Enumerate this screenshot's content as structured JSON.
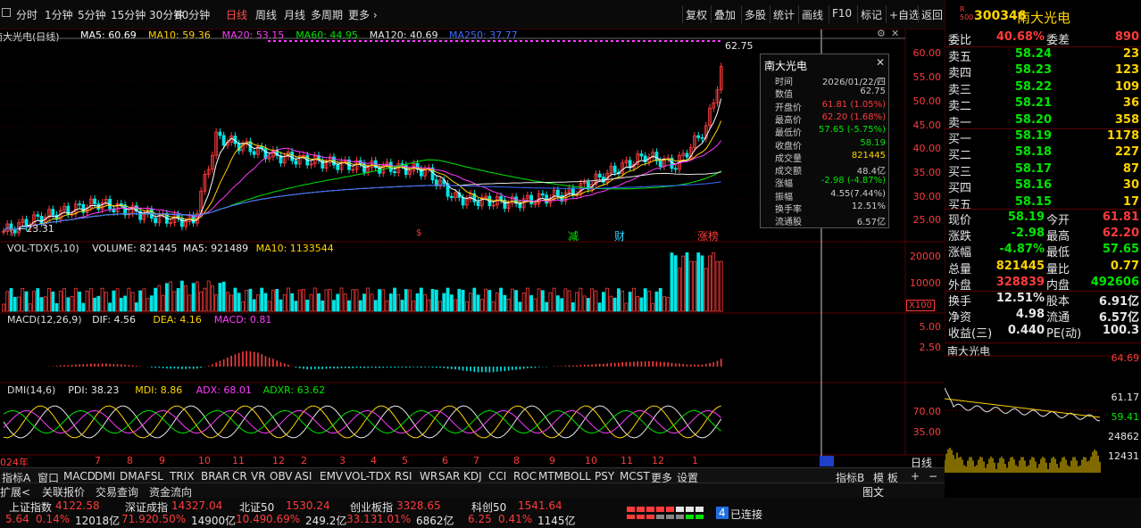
{
  "toolbar": {
    "left_items": [
      "分时",
      "1分钟",
      "5分钟",
      "15分钟",
      "30分钟",
      "60分钟",
      "日线",
      "周线",
      "月线",
      "多周期",
      "更多"
    ],
    "active": "日线",
    "right_items": [
      "复权",
      "叠加",
      "多股",
      "统计",
      "画线",
      "F10",
      "标记",
      "+自选",
      "返回"
    ]
  },
  "stock": {
    "code": "300346",
    "name": "南大光电",
    "market_badge": "R 500"
  },
  "main_chart": {
    "legend_title": "南大光电(日线)",
    "ma": [
      {
        "label": "MA5: 60.69",
        "color": "#ffffff"
      },
      {
        "label": "MA10: 59.36",
        "color": "#ffd400"
      },
      {
        "label": "MA20: 53.15",
        "color": "#ff3bff"
      },
      {
        "label": "MA60: 44.95",
        "color": "#00e600"
      },
      {
        "label": "MA120: 40.69",
        "color": "#e6e6e6"
      },
      {
        "label": "MA250: 37.77",
        "color": "#3b6bff"
      }
    ],
    "y_ticks": [
      "60.00",
      "55.00",
      "50.00",
      "45.00",
      "40.00",
      "35.00",
      "30.00",
      "25.00"
    ],
    "high_marker": "62.75",
    "low_marker": "←23.31",
    "event_marks": [
      {
        "text": "减",
        "color": "#00e600"
      },
      {
        "text": "财",
        "color": "#2ad2ff"
      },
      {
        "text": "涨榜",
        "color": "#ff3b3b"
      }
    ]
  },
  "tooltip": {
    "title": "南大光电",
    "rows": [
      {
        "k": "时间",
        "v": "2026/01/22/四",
        "c": "#cccccc"
      },
      {
        "k": "数值",
        "v": "62.75",
        "c": "#cccccc"
      },
      {
        "k": "开盘价",
        "v": "61.81 (1.05%)",
        "c": "#ff3b3b"
      },
      {
        "k": "最高价",
        "v": "62.20 (1.68%)",
        "c": "#ff3b3b"
      },
      {
        "k": "最低价",
        "v": "57.65 (-5.75%)",
        "c": "#00e600"
      },
      {
        "k": "收盘价",
        "v": "58.19",
        "c": "#00e600"
      },
      {
        "k": "成交量",
        "v": "821445",
        "c": "#ffd400"
      },
      {
        "k": "成交额",
        "v": "48.4亿",
        "c": "#cccccc"
      },
      {
        "k": "涨幅",
        "v": "-2.98 (-4.87%)",
        "c": "#00e600"
      },
      {
        "k": "振幅",
        "v": "4.55(7.44%)",
        "c": "#cccccc"
      },
      {
        "k": "换手率",
        "v": "12.51%",
        "c": "#cccccc"
      },
      {
        "k": "流通股",
        "v": "6.57亿",
        "c": "#cccccc"
      }
    ]
  },
  "volume": {
    "legend": [
      {
        "t": "VOL-TDX(5,10)",
        "c": "#dddddd"
      },
      {
        "t": "VOLUME: 821445",
        "c": "#e6e6e6"
      },
      {
        "t": "MA5: 921489",
        "c": "#e6e6e6"
      },
      {
        "t": "MA10: 1133544",
        "c": "#ffd400"
      }
    ],
    "y_ticks": [
      "20000",
      "10000"
    ],
    "unit": "X100"
  },
  "macd": {
    "legend": [
      {
        "t": "MACD(12,26,9)",
        "c": "#dddddd"
      },
      {
        "t": "DIF: 4.56",
        "c": "#e6e6e6"
      },
      {
        "t": "DEA: 4.16",
        "c": "#ffd400"
      },
      {
        "t": "MACD: 0.81",
        "c": "#ff3bff"
      }
    ],
    "y_ticks": [
      "5.00",
      "2.50"
    ]
  },
  "dmi": {
    "legend": [
      {
        "t": "DMI(14,6)",
        "c": "#dddddd"
      },
      {
        "t": "PDI: 38.23",
        "c": "#e6e6e6"
      },
      {
        "t": "MDI: 8.86",
        "c": "#ffd400"
      },
      {
        "t": "ADX: 68.01",
        "c": "#ff3bff"
      },
      {
        "t": "ADXR: 63.62",
        "c": "#00e600"
      }
    ],
    "y_ticks": [
      "70.00",
      "35.00"
    ]
  },
  "x_axis": {
    "labels": [
      "024年",
      "7",
      "8",
      "9",
      "10",
      "11",
      "12",
      "2",
      "3",
      "4",
      "5",
      "6",
      "7",
      "8",
      "9",
      "10",
      "11",
      "12",
      "1"
    ],
    "right_label": "日线"
  },
  "bottom_tabs": [
    "指标A",
    "窗口",
    "MACD",
    "DMI",
    "DMA",
    "FSL",
    "TRIX",
    "BRAR",
    "CR",
    "VR",
    "OBV",
    "ASI",
    "EMV",
    "VOL-TDX",
    "RSI",
    "WR",
    "SAR",
    "KDJ",
    "CCI",
    "ROC",
    "MTM",
    "BOLL",
    "PSY",
    "MCST",
    "更多",
    "设置"
  ],
  "bottom_right_tabs": [
    "指标B",
    "模 板"
  ],
  "extra_tabs": [
    "扩展<",
    "关联报价",
    "交易查询",
    "资金流向"
  ],
  "quote": {
    "weibi": {
      "k": "委比",
      "v": "40.68%",
      "k2": "委差",
      "v2": "890"
    },
    "sell": [
      {
        "k": "卖五",
        "p": "58.24",
        "q": "23"
      },
      {
        "k": "卖四",
        "p": "58.23",
        "q": "123"
      },
      {
        "k": "卖三",
        "p": "58.22",
        "q": "109"
      },
      {
        "k": "卖二",
        "p": "58.21",
        "q": "36"
      },
      {
        "k": "卖一",
        "p": "58.20",
        "q": "358"
      }
    ],
    "buy": [
      {
        "k": "买一",
        "p": "58.19",
        "q": "1178"
      },
      {
        "k": "买二",
        "p": "58.18",
        "q": "227"
      },
      {
        "k": "买三",
        "p": "58.17",
        "q": "87"
      },
      {
        "k": "买四",
        "p": "58.16",
        "q": "30"
      },
      {
        "k": "买五",
        "p": "58.15",
        "q": "17"
      }
    ],
    "stats": [
      {
        "k": "现价",
        "v": "58.19",
        "vc": "#00e600",
        "k2": "今开",
        "v2": "61.81",
        "v2c": "#ff3b3b"
      },
      {
        "k": "涨跌",
        "v": "-2.98",
        "vc": "#00e600",
        "k2": "最高",
        "v2": "62.20",
        "v2c": "#ff3b3b"
      },
      {
        "k": "涨幅",
        "v": "-4.87%",
        "vc": "#00e600",
        "k2": "最低",
        "v2": "57.65",
        "v2c": "#00e600"
      },
      {
        "k": "总量",
        "v": "821445",
        "vc": "#ffd400",
        "k2": "量比",
        "v2": "0.77",
        "v2c": "#ffd400"
      },
      {
        "k": "外盘",
        "v": "328839",
        "vc": "#ff3b3b",
        "k2": "内盘",
        "v2": "492606",
        "v2c": "#00e600"
      }
    ],
    "stats2": [
      {
        "k": "换手",
        "v": "12.51%",
        "k2": "股本",
        "v2": "6.91亿"
      },
      {
        "k": "净资",
        "v": "4.98",
        "k2": "流通",
        "v2": "6.57亿"
      },
      {
        "k": "收益(三)",
        "v": "0.440",
        "k2": "PE(动)",
        "v2": "100.3"
      }
    ]
  },
  "mini_chart": {
    "title": "南大光电",
    "y_ticks": [
      "64.69",
      "61.17",
      "59.41",
      "24862",
      "12431"
    ]
  },
  "right_bottom": {
    "tab": "图文"
  },
  "status": {
    "indices": [
      {
        "name": "上证指数",
        "val": "4122.58",
        "chg": "5.64",
        "pct": "0.14%",
        "amt": "12018亿"
      },
      {
        "name": "深证成指",
        "val": "14327.04",
        "chg": "71.92",
        "pct": "0.50%",
        "amt": "14900亿"
      },
      {
        "name": "北证50",
        "val": "1530.24",
        "chg": "10.49",
        "pct": "0.69%",
        "amt": "249.2亿"
      },
      {
        "name": "创业板指",
        "val": "3328.65",
        "chg": "33.13",
        "pct": "1.01%",
        "amt": "6862亿"
      },
      {
        "name": "科创50",
        "val": "1541.64",
        "chg": "6.25",
        "pct": "0.41%",
        "amt": "1145亿"
      }
    ],
    "conn_num": "4",
    "conn_text": "已连接"
  },
  "colors": {
    "up": "#ff3b3b",
    "down": "#00e600",
    "grid": "#3a0000",
    "axis_text": "#ff3b3b"
  }
}
